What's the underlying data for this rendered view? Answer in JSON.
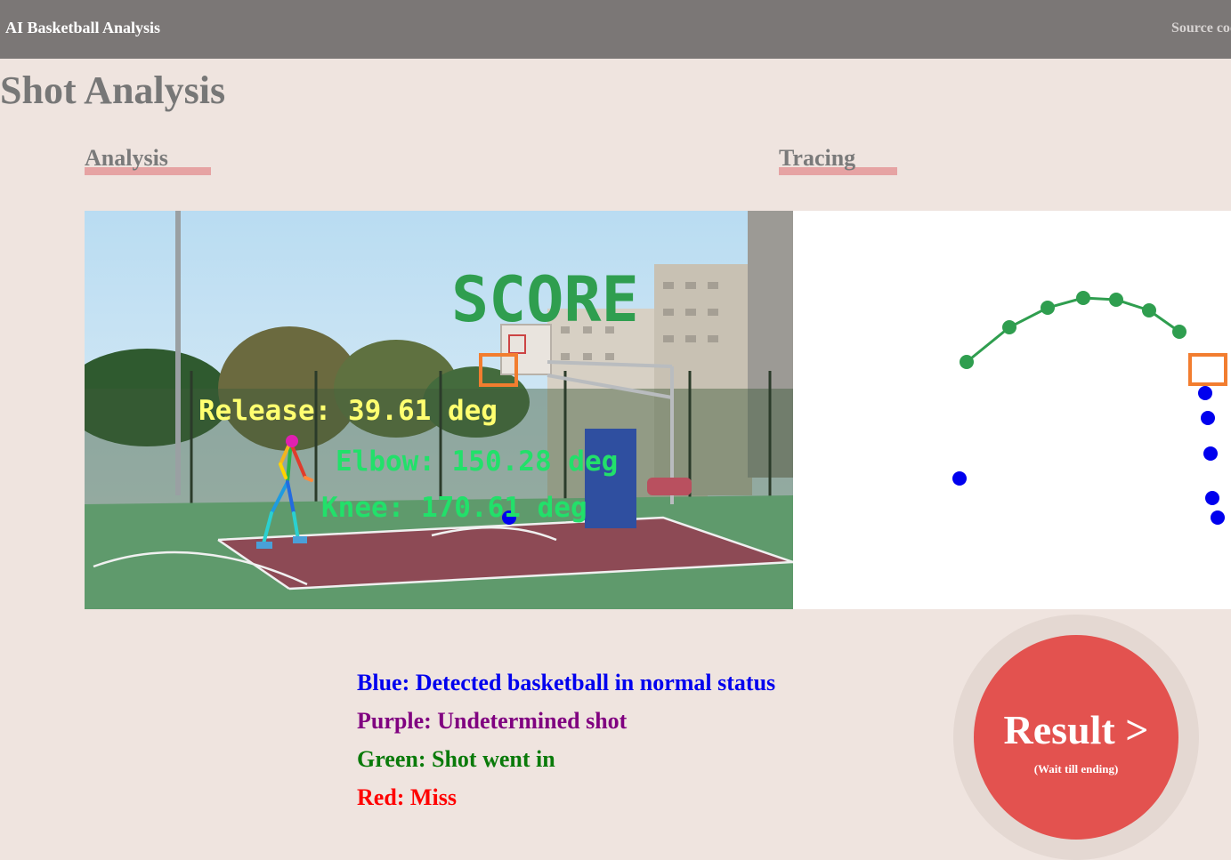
{
  "navbar": {
    "brand": "AI Basketball Analysis",
    "source_link": "Source code"
  },
  "page": {
    "title": "Shot Analysis"
  },
  "sections": {
    "analysis": "Analysis",
    "tracing": "Tracing"
  },
  "video_overlay": {
    "score_text": "SCORE",
    "release": "Release: 39.61 deg",
    "elbow": "Elbow: 150.28 deg",
    "knee": "Knee: 170.61 deg"
  },
  "legend": {
    "blue": "Blue: Detected basketball in normal status",
    "purple": "Purple: Undetermined shot",
    "green": "Green: Shot went in",
    "red": "Red: Miss"
  },
  "result": {
    "label": "Result >",
    "sub": "(Wait till ending)"
  },
  "colors": {
    "nav_bg": "#7b7776",
    "page_bg": "#efe4df",
    "accent_underline": "#e6a3a3",
    "result_button": "#e3524f",
    "trajectory_green": "#2f9e4f",
    "ball_blue": "#0000ee",
    "hoop_orange": "#f27d2f"
  }
}
